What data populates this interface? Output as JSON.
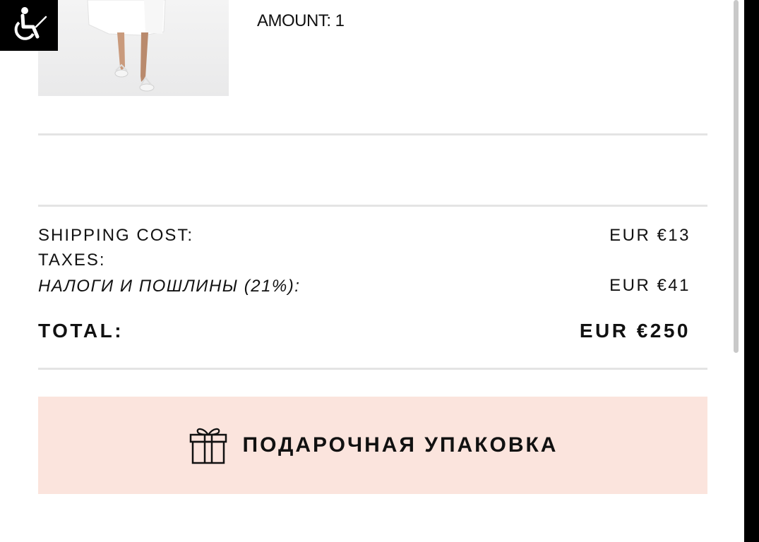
{
  "product": {
    "amount_text": "AMOUNT: 1"
  },
  "summary": {
    "shipping_label": "SHIPPING COST:",
    "shipping_value": "EUR €13",
    "taxes_label": "TAXES:",
    "duties_label": "НАЛОГИ И ПОШЛИНЫ (21%):",
    "duties_value": "EUR €41",
    "total_label": "TOTAL:",
    "total_value": "EUR €250"
  },
  "gift": {
    "label": "ПОДАРОЧНАЯ УПАКОВКА",
    "icon": "gift-icon",
    "background": "#fbe4dd"
  },
  "accessibility": {
    "icon": "accessibility-icon"
  }
}
